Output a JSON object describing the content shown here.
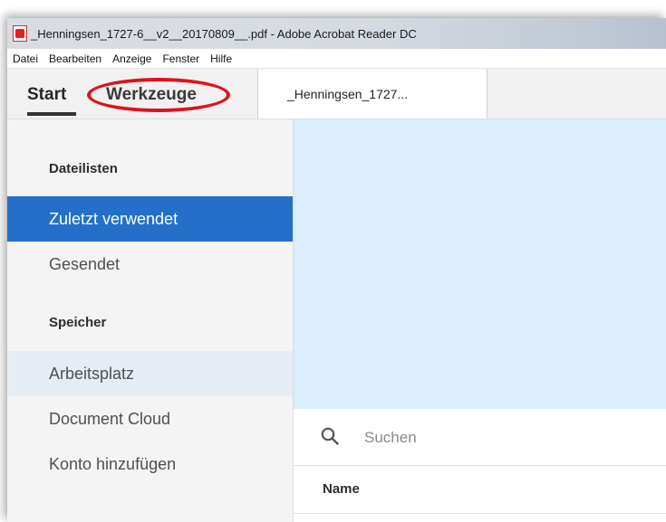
{
  "window": {
    "title": "_Henningsen_1727-6__v2__20170809__.pdf - Adobe Acrobat Reader DC"
  },
  "menu": [
    "Datei",
    "Bearbeiten",
    "Anzeige",
    "Fenster",
    "Hilfe"
  ],
  "tabs": {
    "start": "Start",
    "tools": "Werkzeuge",
    "document": "_Henningsen_1727..."
  },
  "sidebar": {
    "file_lists_heading": "Dateilisten",
    "items_files": [
      "Zuletzt verwendet",
      "Gesendet"
    ],
    "storage_heading": "Speicher",
    "items_storage": [
      "Arbeitsplatz",
      "Document Cloud",
      "Konto hinzufügen"
    ]
  },
  "search": {
    "placeholder": "Suchen"
  },
  "list": {
    "column_name": "Name"
  },
  "colors": {
    "active_item": "#2470c8",
    "banner": "#daeefb",
    "annotation_circle": "#e0111b"
  },
  "icons": [
    "acrobat-app-icon",
    "search-icon"
  ]
}
